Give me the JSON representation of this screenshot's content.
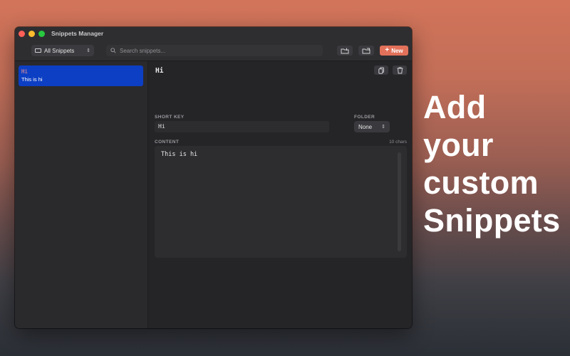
{
  "window": {
    "title": "Snippets Manager",
    "traffic_lights": {
      "close": "#fe5f57",
      "minimize": "#febc2e",
      "zoom": "#28c840"
    }
  },
  "toolbar": {
    "scope_select": {
      "icon": "tray-icon",
      "value": "All Snippets"
    },
    "search": {
      "placeholder": "Search snippets..."
    },
    "import_icon": "folder-import-icon",
    "export_icon": "folder-export-icon",
    "new_button": {
      "label": "New",
      "color": "#e3715a"
    }
  },
  "sidebar": {
    "items": [
      {
        "key": "Hi",
        "preview": "This is hi",
        "selected": true,
        "selected_color": "#0d3fc4"
      }
    ]
  },
  "detail": {
    "title": "Hi",
    "copy_icon": "copy-icon",
    "delete_icon": "trash-icon",
    "short_key": {
      "label": "SHORT KEY",
      "value": "Hi"
    },
    "folder": {
      "label": "FOLDER",
      "value": "None"
    },
    "content": {
      "label": "CONTENT",
      "char_count": "10 chars",
      "value": "This is hi"
    }
  },
  "marketing": {
    "lines": [
      "Add",
      "your",
      "custom",
      "Snippets"
    ]
  }
}
